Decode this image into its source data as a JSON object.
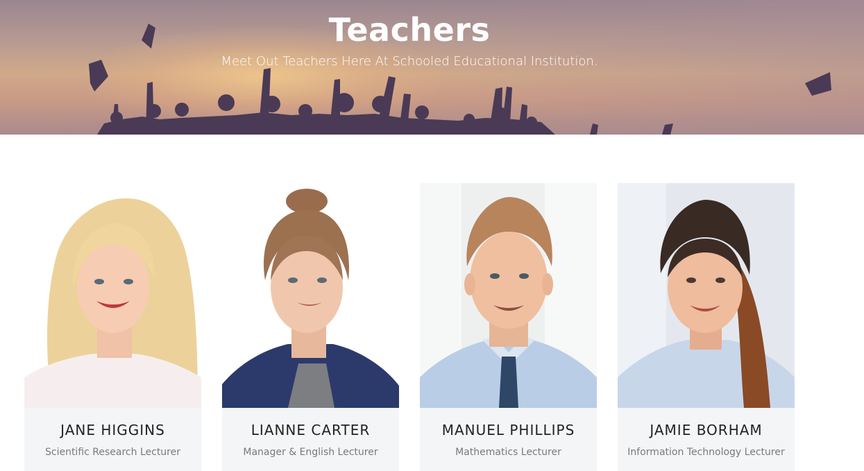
{
  "hero": {
    "title": "Teachers",
    "subtitle": "Meet Out Teachers Here At Schooled Educational Institution."
  },
  "teachers": [
    {
      "name": "JANE HIGGINS",
      "role": "Scientific Research Lecturer"
    },
    {
      "name": "LIANNE CARTER",
      "role": "Manager & English Lecturer"
    },
    {
      "name": "MANUEL PHILLIPS",
      "role": "Mathematics Lecturer"
    },
    {
      "name": "JAMIE BORHAM",
      "role": "Information Technology Lecturer"
    }
  ],
  "colors": {
    "card_info_bg": "#f4f5f7",
    "name_text": "#222222",
    "role_text": "#7a7a7a",
    "hero_text": "#ffffff"
  }
}
